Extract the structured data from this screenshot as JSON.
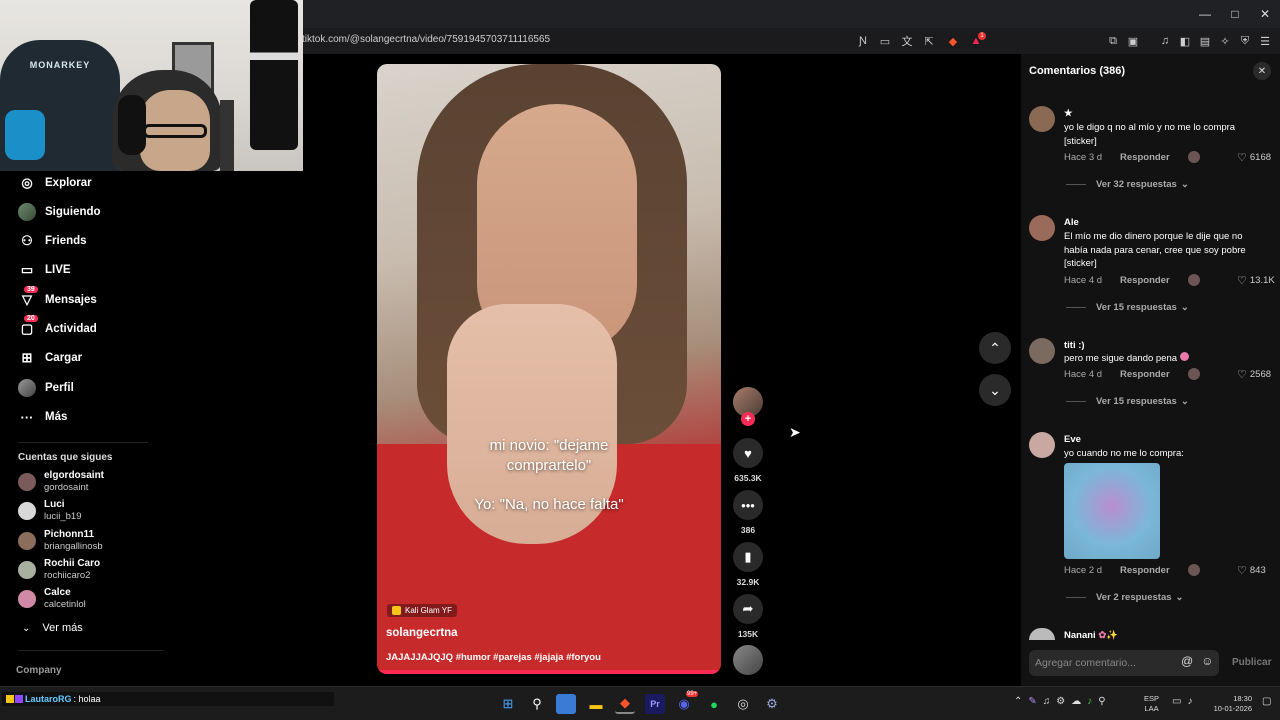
{
  "browser": {
    "url": "tiktok.com/@solangecrtna/video/7591945703711116565",
    "window_controls": [
      "—",
      "□",
      "✕"
    ],
    "address_icons": [
      "no-translate",
      "screen",
      "translate",
      "share",
      "brave-shield",
      "rewards"
    ],
    "toolbar_icons": [
      "extensions",
      "tab",
      "music",
      "sidebar",
      "wallet",
      "leo",
      "vpn",
      "menu"
    ],
    "rewards_badge": "1"
  },
  "sidebar": {
    "nav": [
      {
        "label": "Explorar",
        "icon": "compass-icon",
        "glyph": "◎"
      },
      {
        "label": "Siguiendo",
        "icon": "following-avatar-icon",
        "glyph": "●"
      },
      {
        "label": "Friends",
        "icon": "friends-icon",
        "glyph": "👥"
      },
      {
        "label": "LIVE",
        "icon": "live-icon",
        "glyph": "▭"
      },
      {
        "label": "Mensajes",
        "icon": "messages-icon",
        "glyph": "▽",
        "badge": "39"
      },
      {
        "label": "Actividad",
        "icon": "activity-icon",
        "glyph": "▢",
        "badge": "20"
      },
      {
        "label": "Cargar",
        "icon": "upload-icon",
        "glyph": "⊞"
      },
      {
        "label": "Perfil",
        "icon": "profile-avatar-icon",
        "glyph": "●"
      },
      {
        "label": "Más",
        "icon": "more-icon",
        "glyph": "···"
      }
    ],
    "following_title": "Cuentas que sigues",
    "accounts": [
      {
        "name": "elgordosaint",
        "handle": "gordosaint",
        "color": "#7a5a5a"
      },
      {
        "name": "Luci",
        "handle": "lucii_b19",
        "color": "#d8d8d8"
      },
      {
        "name": "Pichonn11",
        "handle": "briangallinosb",
        "color": "#8a6d5a"
      },
      {
        "name": "Rochii Caro",
        "handle": "rochiicaro2",
        "color": "#a8b0a0"
      },
      {
        "name": "Calce",
        "handle": "calcetinlol",
        "color": "#d08aa8"
      }
    ],
    "see_more": "Ver más",
    "company": "Company"
  },
  "video": {
    "caption_1a": "mi novio: \"dejame",
    "caption_1b": "comprartelo\"",
    "caption_2": "Yo: \"Na, no hace falta\"",
    "effect": "Kali Glam YF",
    "username": "solangecrtna",
    "description": "JAJAJJAJQJQ #humor #parejas #jajaja #foryou",
    "progress": 1.0
  },
  "actions": {
    "likes": "635.3K",
    "comments": "386",
    "saves": "32.9K",
    "shares": "135K"
  },
  "comments": {
    "title": "Comentarios",
    "count": "(386)",
    "items": [
      {
        "name": "★",
        "text": "yo le digo q no al mío y no me lo compra [sticker]",
        "time": "Hace 3 d",
        "reply": "Responder",
        "likes": "6168",
        "more": "Ver 32 respuestas",
        "avatar": "#8a6a55"
      },
      {
        "name": "Ale",
        "text": "El mío me dio dinero porque le dije que no había nada para cenar, cree que soy pobre [sticker]",
        "time": "Hace 4 d",
        "reply": "Responder",
        "likes": "13.1K",
        "more": "Ver 15 respuestas",
        "avatar": "#9a6a5a"
      },
      {
        "name": "titi :)",
        "text": "pero me sigue dando pena",
        "time": "Hace 4 d",
        "reply": "Responder",
        "likes": "2568",
        "more": "Ver 15 respuestas",
        "avatar": "#7a6a60"
      },
      {
        "name": "Eve",
        "text": "yo cuando no me lo compra:",
        "time": "Hace 2 d",
        "reply": "Responder",
        "likes": "843",
        "more": "Ver 2 respuestas",
        "avatar": "#c8a8a0"
      },
      {
        "name": "Nanani",
        "text": "",
        "avatar": "#bbbbbb"
      }
    ],
    "input_placeholder": "Agregar comentario...",
    "publish": "Publicar"
  },
  "taskbar": {
    "chat_user": "LautaroRG",
    "chat_msg": ": holaa",
    "apps": [
      "windows-start",
      "search",
      "photos",
      "file-explorer",
      "brave",
      "premiere",
      "discord",
      "spotify",
      "obs",
      "steam"
    ],
    "discord_badge": "99+",
    "lang_1": "ESP",
    "lang_2": "LAA",
    "time": "18:30",
    "date": "10-01-2026"
  }
}
